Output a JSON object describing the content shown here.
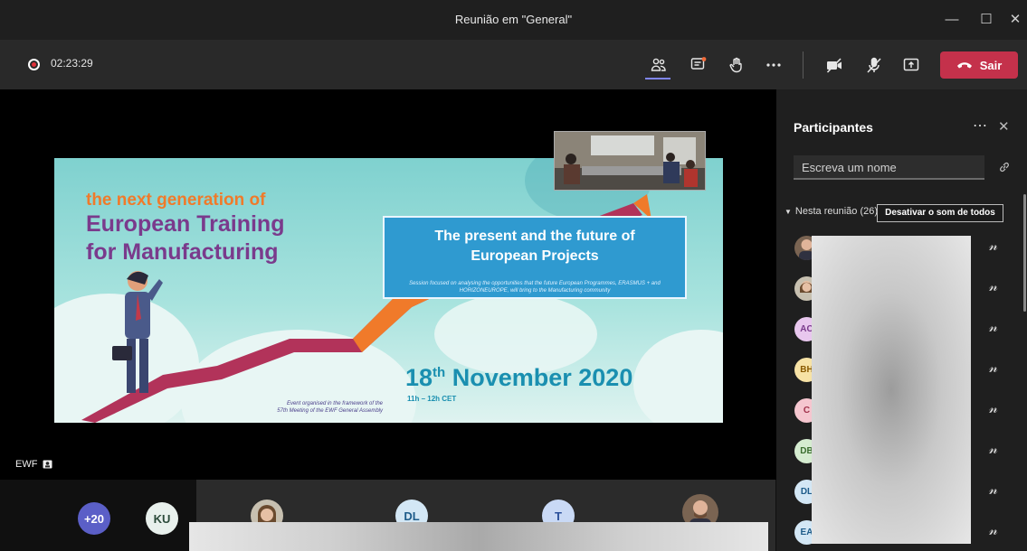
{
  "window": {
    "title": "Reunião em \"General\""
  },
  "controls": {
    "recording_time": "02:23:29",
    "leave_label": "Sair",
    "accent": "#7f85f5",
    "leave_color": "#c4314b"
  },
  "stage": {
    "presenter_label": "EWF",
    "slide": {
      "headline_small": "the next generation of",
      "headline_line1": "European Training",
      "headline_line2": "for Manufacturing",
      "box_title_line1": "The present and the future of",
      "box_title_line2": "European Projects",
      "box_subtitle": "Session focused on analysing the opportunities that the future European Programmes, ERASMUS + and HORIZONEUROPE, will bring to the Manufacturing community",
      "date_day": "18",
      "date_suffix": "th",
      "date_rest": " November 2020",
      "hours": "11h – 12h CET",
      "event_line1": "Event organised in the framework of the",
      "event_line2": "57th Meeting of the EWF General Assembly"
    }
  },
  "panel": {
    "title": "Participantes",
    "search_placeholder": "Escreva um nome",
    "section_label": "Nesta reunião (26)",
    "mute_all_label": "Desativar o som de todos",
    "participants": [
      {
        "initials": "",
        "bg": "#c9a88a"
      },
      {
        "initials": "",
        "bg": "#d8b89a"
      },
      {
        "initials": "AC",
        "bg": "#e8c7ee",
        "fg": "#7a3b8c"
      },
      {
        "initials": "BH",
        "bg": "#f7e2a5",
        "fg": "#8a5a00"
      },
      {
        "initials": "C",
        "bg": "#f5c6cf",
        "fg": "#a0304a"
      },
      {
        "initials": "DB",
        "bg": "#d5ecd0",
        "fg": "#3b6e2f"
      },
      {
        "initials": "DL",
        "bg": "#d3e7f5",
        "fg": "#1e5c8a"
      },
      {
        "initials": "EA",
        "bg": "#d3e7f5",
        "fg": "#1e5c8a"
      }
    ]
  },
  "gallery": {
    "overflow_count": "+20",
    "tiles": [
      {
        "initials": "KU"
      },
      {
        "initials": ""
      },
      {
        "initials": "DL"
      },
      {
        "initials": "T"
      },
      {
        "initials": ""
      }
    ]
  }
}
